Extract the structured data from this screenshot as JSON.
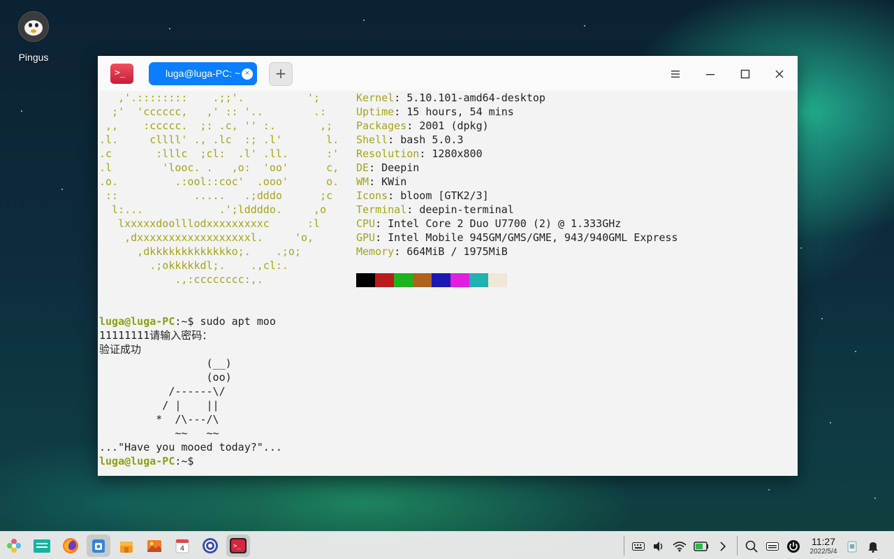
{
  "desktop": {
    "icons": [
      {
        "label": "Pingus",
        "icon": "penguin-icon"
      }
    ]
  },
  "terminal": {
    "tab_title": "luga@luga-PC: ~",
    "tab_close": "×",
    "new_tab": "+",
    "logo_lines": [
      "   ,'.::::::::    .;;'.          ';",
      "  ;'  'cccccc,   ,' :: '..        .:",
      " ,,    :ccccc.  ;: .c, '' :.       ,;",
      ".l.     cllll' ., .lc  :; .l'       l.",
      ".c       :lllc  ;cl:  .l' .ll.      :'",
      ".l        'looc. .   ,o:  'oo'      c,",
      ".o.         .:ool::coc'  .ooo'      o.",
      " ::            .....   .;dddo      ;c",
      "  l:...            .';lddddo.     ,o",
      "   lxxxxxdoolllodxxxxxxxxxc      :l",
      "    ,dxxxxxxxxxxxxxxxxxxl.     'o,",
      "      ,dkkkkkkkkkkkkko;.    .;o;",
      "        .;okkkkkdl;.    .,cl:.",
      "            .,:cccccccc:,."
    ],
    "info": [
      {
        "key": "Kernel",
        "value": "5.10.101-amd64-desktop"
      },
      {
        "key": "Uptime",
        "value": "15 hours, 54 mins"
      },
      {
        "key": "Packages",
        "value": "2001 (dpkg)"
      },
      {
        "key": "Shell",
        "value": "bash 5.0.3"
      },
      {
        "key": "Resolution",
        "value": "1280x800"
      },
      {
        "key": "DE",
        "value": "Deepin"
      },
      {
        "key": "WM",
        "value": "KWin"
      },
      {
        "key": "Icons",
        "value": "bloom [GTK2/3]"
      },
      {
        "key": "Terminal",
        "value": "deepin-terminal"
      },
      {
        "key": "CPU",
        "value": "Intel Core 2 Duo U7700 (2) @ 1.333GHz"
      },
      {
        "key": "GPU",
        "value": "Intel Mobile 945GM/GMS/GME, 943/940GML Express"
      },
      {
        "key": "Memory",
        "value": "664MiB / 1975MiB"
      }
    ],
    "info_separator": ": ",
    "swatch_colors": [
      "#000000",
      "#b81c1c",
      "#1db31d",
      "#b0621b",
      "#1c1ab0",
      "#e01fe0",
      "#1fb2b2",
      "#efe8d8"
    ],
    "prompt_user": "luga@luga-PC",
    "prompt_path": ":~$",
    "command": " sudo apt moo",
    "password_line": "11111111请输入密码：",
    "auth_line": "验证成功",
    "cow_lines": [
      "                 (__)",
      "                 (oo)",
      "           /------\\/",
      "          / |    ||",
      "         *  /\\---/\\",
      "            ~~   ~~"
    ],
    "moo_line": "...\"Have you mooed today?\"...",
    "final_prompt_user": "luga@luga-PC",
    "final_prompt_path": ":~$"
  },
  "taskbar": {
    "apps": [
      {
        "name": "launcher-icon",
        "glyph": "✿"
      },
      {
        "name": "file-manager-icon",
        "glyph": "▤"
      },
      {
        "name": "firefox-icon",
        "glyph": "●"
      },
      {
        "name": "app-store-icon",
        "glyph": "⬛"
      },
      {
        "name": "shop-icon",
        "glyph": "▦"
      },
      {
        "name": "image-viewer-icon",
        "glyph": "▩"
      },
      {
        "name": "calendar-icon",
        "glyph": "4"
      },
      {
        "name": "settings-icon",
        "glyph": "⚙"
      },
      {
        "name": "terminal-icon",
        "glyph": ">_"
      }
    ],
    "tray": [
      {
        "name": "keyboard-icon",
        "glyph": "⌨"
      },
      {
        "name": "volume-icon",
        "glyph": "🔈"
      },
      {
        "name": "wifi-icon",
        "glyph": "≋"
      },
      {
        "name": "battery-icon",
        "glyph": "▭"
      },
      {
        "name": "chevron-right-icon",
        "glyph": "›"
      },
      {
        "name": "search-icon",
        "glyph": "⌕"
      },
      {
        "name": "onscreen-keyboard-icon",
        "glyph": "▭"
      },
      {
        "name": "power-icon",
        "glyph": "⏻"
      }
    ],
    "time": "11:27",
    "date": "2022/5/4",
    "trash": "▯",
    "notification": "🔔"
  }
}
